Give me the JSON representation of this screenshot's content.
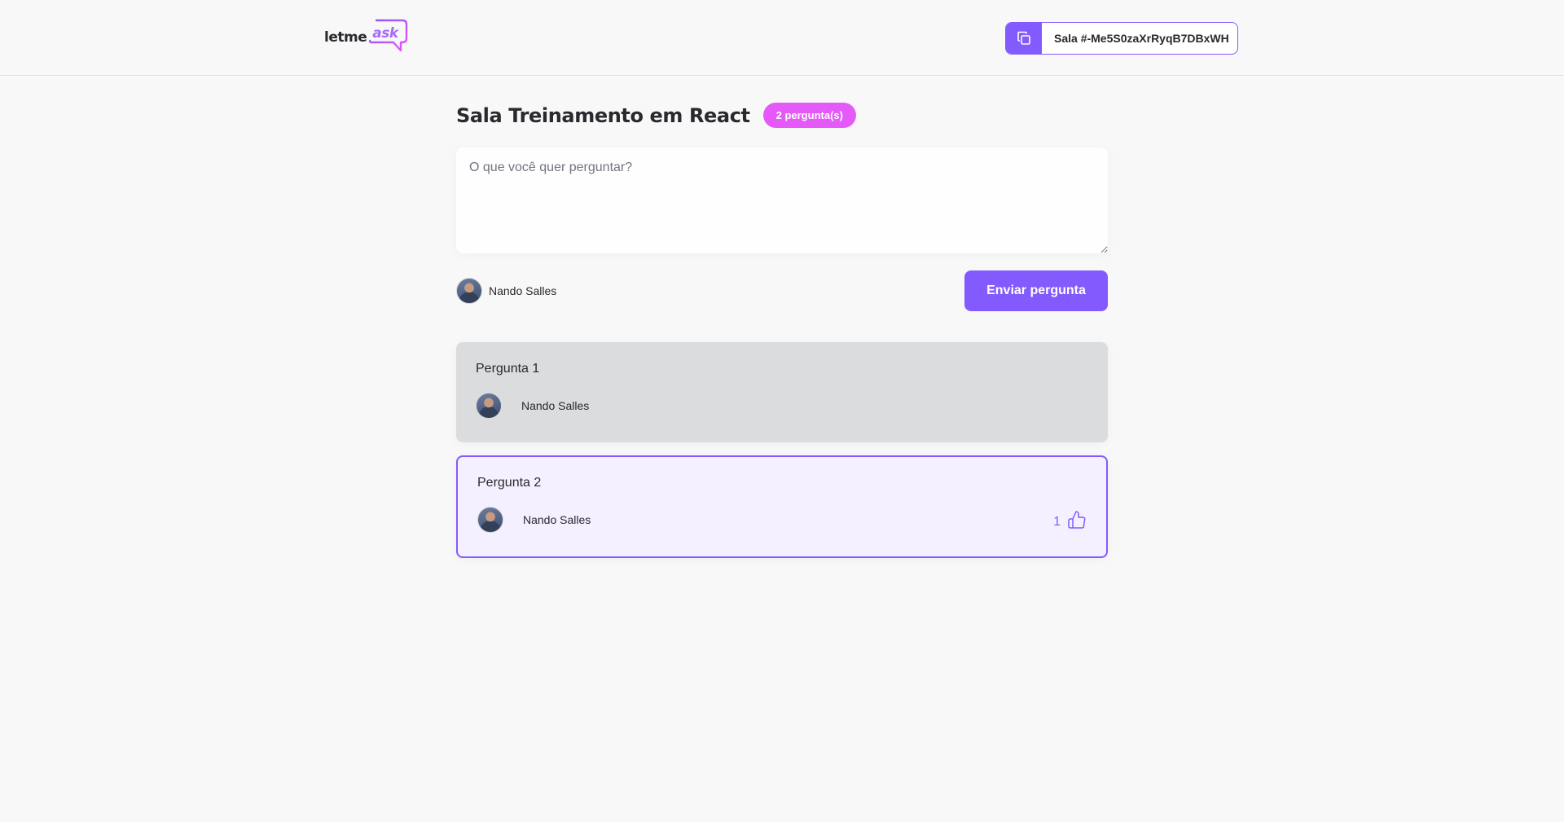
{
  "header": {
    "logo_text": "letme",
    "logo_accent": "ask",
    "room_code": "Sala #-Me5S0zaXrRyqB7DBxWH"
  },
  "room": {
    "title": "Sala Treinamento em React",
    "question_count": "2 pergunta(s)"
  },
  "form": {
    "placeholder": "O que você quer perguntar?",
    "user_name": "Nando Salles",
    "submit_label": "Enviar pergunta"
  },
  "questions": [
    {
      "content": "Pergunta 1",
      "author": "Nando Salles",
      "state": "answered"
    },
    {
      "content": "Pergunta 2",
      "author": "Nando Salles",
      "state": "highlighted",
      "likes": "1"
    }
  ],
  "colors": {
    "accent": "#835afd",
    "badge": "#e559f9",
    "answered_bg": "#dbdcdd",
    "highlighted_bg": "#f4f0ff"
  },
  "icons": {
    "copy": "copy-icon",
    "like": "thumbs-up-icon"
  }
}
